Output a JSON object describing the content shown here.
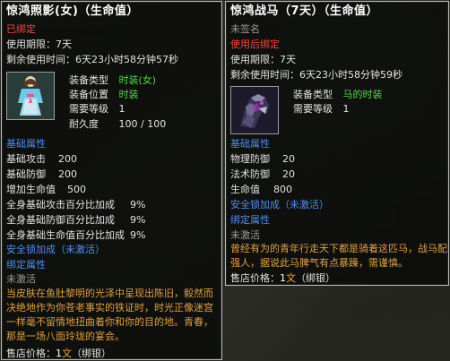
{
  "left_item": {
    "name": "惊鸿照影(女)（生命值）",
    "bind_status": "已绑定",
    "expiry": "使用期限：7天",
    "remaining": "剩余使用时间：6天23小时58分钟57秒",
    "equip_type_label": "装备类型",
    "equip_type_value": "时装(女)",
    "equip_pos_label": "装备位置",
    "equip_pos_value": "时装",
    "level_label": "需要等级",
    "level_value": "1",
    "durability_label": "耐久度",
    "durability_value": "100 / 100",
    "base_attr_header": "基础属性",
    "stats": [
      {
        "label": "基础攻击",
        "value": "200"
      },
      {
        "label": "基础防御",
        "value": "200"
      },
      {
        "label": "增加生命值",
        "value": "500"
      },
      {
        "label": "全身基础攻击百分比加成",
        "value": "9%"
      },
      {
        "label": "全身基础防御百分比加成",
        "value": "9%"
      },
      {
        "label": "全身基础生命值百分比加成",
        "value": "9%"
      }
    ],
    "safe_lock": "安全锁加成（未激活）",
    "bind_attr": "绑定属性",
    "not_activated": "未激活",
    "description": "当皮肤在鱼肚黎明的光泽中呈现出陈旧，毅然而决绝地作为你苍老事实的铁证时，时光正像迷宫一样毫不留情地扭曲着你和你的目的地。青春，那是一场八面玲珑的宴会。",
    "price_label": "售店价格：",
    "price_amount": "1",
    "price_unit": "文",
    "price_note": "（绑银）"
  },
  "right_item": {
    "name": "惊鸿战马（7天）（生命值）",
    "sign_status": "未签名",
    "bind_rule": "使用后绑定",
    "expiry": "使用期限：7天",
    "remaining": "剩余使用时间：6天23小时58分钟59秒",
    "equip_type_label": "装备类型",
    "equip_type_value": "马的时装",
    "level_label": "需要等级",
    "level_value": "1",
    "base_attr_header": "基础属性",
    "stats": [
      {
        "label": "物理防御",
        "value": "20"
      },
      {
        "label": "法术防御",
        "value": "20"
      },
      {
        "label": "生命值",
        "value": "800"
      }
    ],
    "safe_lock": "安全锁加成（未激活）",
    "bind_attr": "绑定属性",
    "not_activated": "未激活",
    "description": "曾经有为的青年行走天下都是骑着这匹马，战马配强人，据说此马脾气有点暴躁，需谨慎。",
    "price_label": "售店价格：",
    "price_amount": "1",
    "price_unit": "文",
    "price_note": "（绑银）"
  },
  "colors": {
    "title": "#ffffff",
    "bound": "#f04a3a",
    "green": "#52d94a",
    "blue": "#4f8df0",
    "description": "#e0a046",
    "grey": "#9a9a9a"
  }
}
